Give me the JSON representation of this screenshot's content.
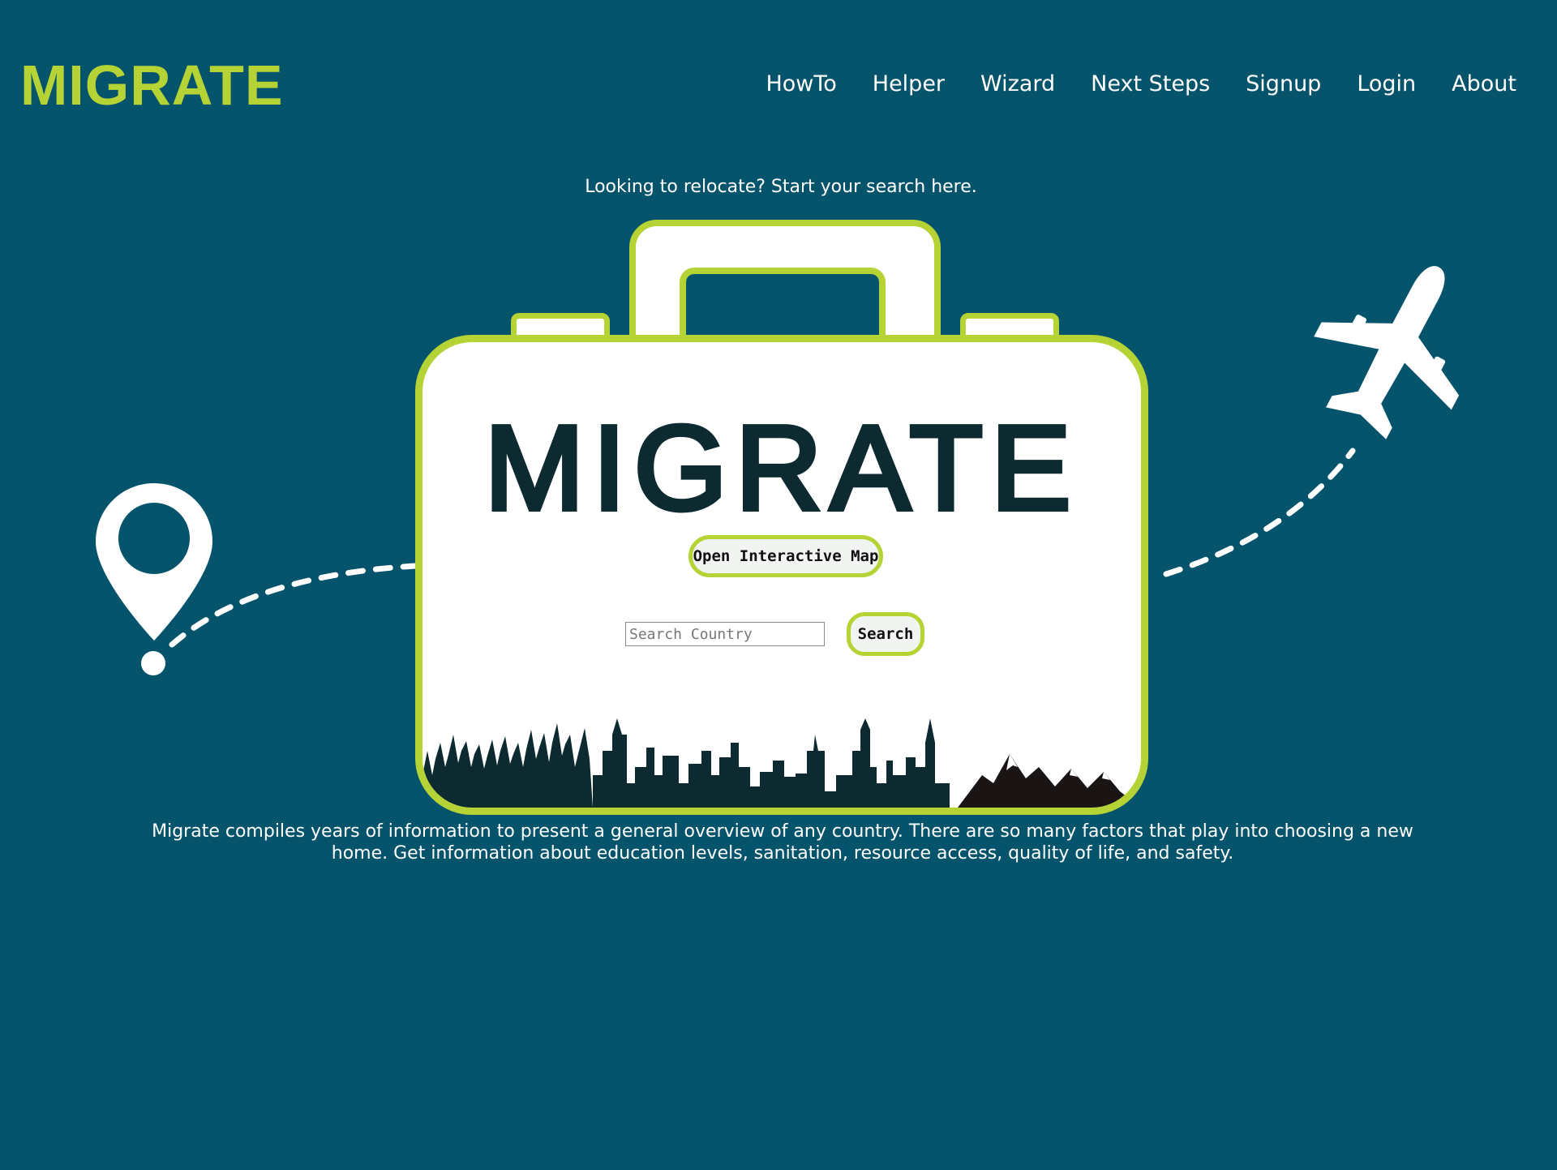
{
  "brand": {
    "logo_text": "MIGRATE",
    "accent_color": "#b5d334",
    "background_color": "#05546c",
    "dark_text_color": "#0c2a30"
  },
  "nav": {
    "items": [
      {
        "label": "HowTo"
      },
      {
        "label": "Helper"
      },
      {
        "label": "Wizard"
      },
      {
        "label": "Next Steps"
      },
      {
        "label": "Signup"
      },
      {
        "label": "Login"
      },
      {
        "label": "About"
      }
    ]
  },
  "hero": {
    "tagline": "Looking to relocate? Start your search here.",
    "suitcase_title": "MIGRATE",
    "map_button_label": "Open Interactive Map",
    "search": {
      "placeholder": "Search Country",
      "value": "",
      "button_label": "Search"
    }
  },
  "description": "Migrate compiles years of information to present a general overview of any country. There are so many factors that play into choosing a new home. Get information about education levels, sanitation, resource access, quality of life, and safety.",
  "icons": {
    "location": "location-pin-icon",
    "airplane": "airplane-icon",
    "skyline": "skyline-illustration"
  }
}
